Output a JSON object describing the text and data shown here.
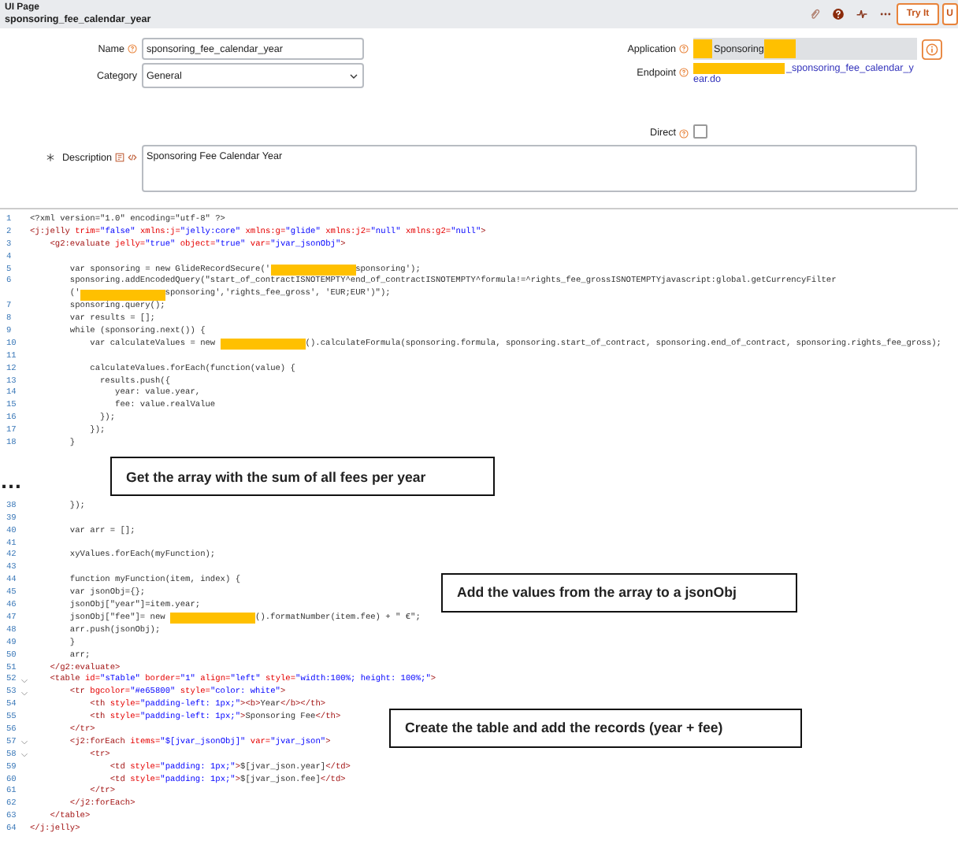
{
  "header": {
    "type_label": "UI Page",
    "record_name": "sponsoring_fee_calendar_year",
    "buttons": [
      "Try It",
      "U"
    ]
  },
  "form": {
    "name": {
      "label": "Name",
      "value": "sponsoring_fee_calendar_year"
    },
    "category": {
      "label": "Category",
      "value": "General"
    },
    "application": {
      "label": "Application",
      "value": "Sponsoring"
    },
    "endpoint": {
      "label": "Endpoint",
      "value": "_sponsoring_fee_calendar_year.do"
    },
    "direct": {
      "label": "Direct",
      "checked": false
    },
    "description": {
      "label": "Description",
      "required": true,
      "value": "Sponsoring Fee Calendar Year"
    }
  },
  "code_sections": [
    {
      "lines": [
        {
          "number": "1",
          "fold": false,
          "text": "<?xml version=\"1.0\" encoding=\"utf-8\" ?>"
        },
        {
          "number": "2",
          "fold": false,
          "parts": [
            {
              "kind": "tag",
              "text": "<j:jelly"
            },
            {
              "kind": "attribute",
              "text": " trim="
            },
            {
              "kind": "value",
              "text": "\"false\""
            },
            {
              "kind": "attribute",
              "text": " xmlns:j="
            },
            {
              "kind": "value",
              "text": "\"jelly:core\""
            },
            {
              "kind": "attribute",
              "text": " xmlns:g="
            },
            {
              "kind": "value",
              "text": "\"glide\""
            },
            {
              "kind": "attribute",
              "text": " xmlns:j2="
            },
            {
              "kind": "value",
              "text": "\"null\""
            },
            {
              "kind": "attribute",
              "text": " xmlns:g2="
            },
            {
              "kind": "value",
              "text": "\"null\""
            },
            {
              "kind": "tag",
              "text": ">"
            }
          ]
        },
        {
          "number": "3",
          "fold": false,
          "parts": [
            {
              "kind": "tag",
              "text": "    <g2:evaluate"
            },
            {
              "kind": "attribute",
              "text": " jelly="
            },
            {
              "kind": "value",
              "text": "\"true\""
            },
            {
              "kind": "attribute",
              "text": " object="
            },
            {
              "kind": "value",
              "text": "\"true\""
            },
            {
              "kind": "attribute",
              "text": " var="
            },
            {
              "kind": "value",
              "text": "\"jvar_jsonObj\""
            },
            {
              "kind": "tag",
              "text": ">"
            }
          ]
        },
        {
          "number": "4",
          "fold": false
        },
        {
          "number": "5",
          "fold": false,
          "parts": [
            {
              "kind": "plain",
              "text": "        var sponsoring = new GlideRecordSecure('"
            },
            {
              "kind": "redaction"
            },
            {
              "kind": "plain",
              "text": "sponsoring');"
            }
          ]
        },
        {
          "number": "6",
          "fold": false,
          "text": "        sponsoring.addEncodedQuery(\"start_of_contractISNOTEMPTY^end_of_contractISNOTEMPTY^formula!=^rights_fee_grossISNOTEMPTYjavascript:global.getCurrencyFilter"
        },
        {
          "fold": false,
          "parts": [
            {
              "kind": "plain",
              "text": "        ('"
            },
            {
              "kind": "redaction"
            },
            {
              "kind": "plain",
              "text": "sponsoring','rights_fee_gross', 'EUR;EUR')\");"
            }
          ]
        },
        {
          "number": "7",
          "fold": false,
          "text": "        sponsoring.query();"
        },
        {
          "number": "8",
          "fold": false,
          "text": "        var results = [];"
        },
        {
          "number": "9",
          "fold": false,
          "text": "        while (sponsoring.next()) {"
        },
        {
          "number": "10",
          "fold": false,
          "parts": [
            {
              "kind": "plain",
              "text": "            var calculateValues = new "
            },
            {
              "kind": "redaction"
            },
            {
              "kind": "plain",
              "text": "().calculateFormula(sponsoring.formula, sponsoring.start_of_contract, sponsoring.end_of_contract, sponsoring.rights_fee_gross);"
            }
          ]
        },
        {
          "number": "11",
          "fold": false
        },
        {
          "number": "12",
          "fold": false,
          "text": "            calculateValues.forEach(function(value) {"
        },
        {
          "number": "13",
          "fold": false,
          "text": "              results.push({"
        },
        {
          "number": "14",
          "fold": false,
          "text": "                 year: value.year,"
        },
        {
          "number": "15",
          "fold": false,
          "text": "                 fee: value.realValue"
        },
        {
          "number": "16",
          "fold": false,
          "text": "              });"
        },
        {
          "number": "17",
          "fold": false,
          "text": "            });"
        },
        {
          "number": "18",
          "fold": false,
          "text": "        }"
        }
      ]
    },
    {
      "lines": [
        {
          "number": "38",
          "fold": false,
          "text": "        });"
        },
        {
          "number": "39",
          "fold": false
        },
        {
          "number": "40",
          "fold": false,
          "text": "        var arr = [];"
        },
        {
          "number": "41",
          "fold": false
        },
        {
          "number": "42",
          "fold": false,
          "text": "        xyValues.forEach(myFunction);"
        },
        {
          "number": "43",
          "fold": false
        },
        {
          "number": "44",
          "fold": false,
          "text": "        function myFunction(item, index) {"
        },
        {
          "number": "45",
          "fold": false,
          "text": "        var jsonObj={};"
        },
        {
          "number": "46",
          "fold": false,
          "text": "        jsonObj[\"year\"]=item.year;"
        },
        {
          "number": "47",
          "fold": false,
          "parts": [
            {
              "kind": "plain",
              "text": "        jsonObj[\"fee\"]= new "
            },
            {
              "kind": "redaction"
            },
            {
              "kind": "plain",
              "text": "().formatNumber(item.fee) + \" €\";"
            }
          ]
        },
        {
          "number": "48",
          "fold": false,
          "text": "        arr.push(jsonObj);"
        },
        {
          "number": "49",
          "fold": false,
          "text": "        }"
        },
        {
          "number": "50",
          "fold": false,
          "text": "        arr;"
        },
        {
          "number": "51",
          "fold": false,
          "parts": [
            {
              "kind": "tag",
              "text": "    </g2:evaluate>"
            }
          ]
        },
        {
          "number": "52",
          "fold": true,
          "parts": [
            {
              "kind": "tag",
              "text": "    <table"
            },
            {
              "kind": "attribute",
              "text": " id="
            },
            {
              "kind": "value",
              "text": "\"sTable\""
            },
            {
              "kind": "attribute",
              "text": " border="
            },
            {
              "kind": "value",
              "text": "\"1\""
            },
            {
              "kind": "attribute",
              "text": " align="
            },
            {
              "kind": "value",
              "text": "\"left\""
            },
            {
              "kind": "attribute",
              "text": " style="
            },
            {
              "kind": "value",
              "text": "\"width:100%; height: 100%;\""
            },
            {
              "kind": "tag",
              "text": ">"
            }
          ]
        },
        {
          "number": "53",
          "fold": true,
          "parts": [
            {
              "kind": "tag",
              "text": "        <tr"
            },
            {
              "kind": "attribute",
              "text": " bgcolor="
            },
            {
              "kind": "value",
              "text": "\"#e65800\""
            },
            {
              "kind": "attribute",
              "text": " style="
            },
            {
              "kind": "value",
              "text": "\"color: white\""
            },
            {
              "kind": "tag",
              "text": ">"
            }
          ]
        },
        {
          "number": "54",
          "fold": false,
          "parts": [
            {
              "kind": "tag",
              "text": "            <th"
            },
            {
              "kind": "attribute",
              "text": " style="
            },
            {
              "kind": "value",
              "text": "\"padding-left: 1px;\""
            },
            {
              "kind": "tag",
              "text": "><b>"
            },
            {
              "kind": "plain",
              "text": "Year"
            },
            {
              "kind": "tag",
              "text": "</b></th>"
            }
          ]
        },
        {
          "number": "55",
          "fold": false,
          "parts": [
            {
              "kind": "tag",
              "text": "            <th"
            },
            {
              "kind": "attribute",
              "text": " style="
            },
            {
              "kind": "value",
              "text": "\"padding-left: 1px;\""
            },
            {
              "kind": "tag",
              "text": ">"
            },
            {
              "kind": "plain",
              "text": "Sponsoring Fee"
            },
            {
              "kind": "tag",
              "text": "</th>"
            }
          ]
        },
        {
          "number": "56",
          "fold": false,
          "parts": [
            {
              "kind": "tag",
              "text": "        </tr>"
            }
          ]
        },
        {
          "number": "57",
          "fold": true,
          "parts": [
            {
              "kind": "tag",
              "text": "        <j2:forEach"
            },
            {
              "kind": "attribute",
              "text": " items="
            },
            {
              "kind": "value",
              "text": "\"$[jvar_jsonObj]\""
            },
            {
              "kind": "attribute",
              "text": " var="
            },
            {
              "kind": "value",
              "text": "\"jvar_json\""
            },
            {
              "kind": "tag",
              "text": ">"
            }
          ]
        },
        {
          "number": "58",
          "fold": true,
          "parts": [
            {
              "kind": "tag",
              "text": "            <tr>"
            }
          ]
        },
        {
          "number": "59",
          "fold": false,
          "parts": [
            {
              "kind": "tag",
              "text": "                <td"
            },
            {
              "kind": "attribute",
              "text": " style="
            },
            {
              "kind": "value",
              "text": "\"padding: 1px;\""
            },
            {
              "kind": "tag",
              "text": ">"
            },
            {
              "kind": "plain",
              "text": "$[jvar_json.year]"
            },
            {
              "kind": "tag",
              "text": "</td>"
            }
          ]
        },
        {
          "number": "60",
          "fold": false,
          "parts": [
            {
              "kind": "tag",
              "text": "                <td"
            },
            {
              "kind": "attribute",
              "text": " style="
            },
            {
              "kind": "value",
              "text": "\"padding: 1px;\""
            },
            {
              "kind": "tag",
              "text": ">"
            },
            {
              "kind": "plain",
              "text": "$[jvar_json.fee]"
            },
            {
              "kind": "tag",
              "text": "</td>"
            }
          ]
        },
        {
          "number": "61",
          "fold": false,
          "parts": [
            {
              "kind": "tag",
              "text": "            </tr>"
            }
          ]
        },
        {
          "number": "62",
          "fold": false,
          "parts": [
            {
              "kind": "tag",
              "text": "        </j2:forEach>"
            }
          ]
        },
        {
          "number": "63",
          "fold": false,
          "parts": [
            {
              "kind": "tag",
              "text": "    </table>"
            }
          ]
        },
        {
          "number": "64",
          "fold": false,
          "parts": [
            {
              "kind": "tag",
              "text": "</j:jelly>"
            }
          ]
        }
      ],
      "annotations": [
        "Add the values from the array to a jsonObj",
        "Create the table and add the records (year + fee)"
      ]
    }
  ],
  "break": {
    "mark": "…",
    "annotation": "Get the array with the sum of all fees per year"
  }
}
